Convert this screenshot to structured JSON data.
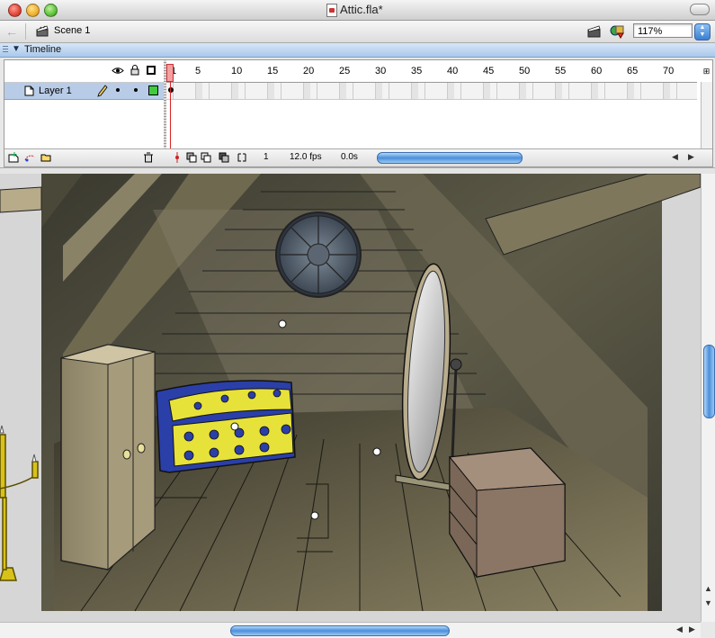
{
  "window": {
    "title": "Attic.fla*"
  },
  "editbar": {
    "scene_label": "Scene 1",
    "zoom": "117%"
  },
  "timeline_panel": {
    "title": "Timeline"
  },
  "timeline": {
    "ruler": [
      "1",
      "5",
      "10",
      "15",
      "20",
      "25",
      "30",
      "35",
      "40",
      "45",
      "50",
      "55",
      "60",
      "65",
      "70"
    ],
    "layer": {
      "name": "Layer 1",
      "color": "#3dcc3d"
    },
    "footer": {
      "current_frame": "1",
      "frame_rate": "12.0 fps",
      "elapsed": "0.0s"
    }
  },
  "stage": {
    "scene": "attic",
    "objects": [
      "round-window-icon",
      "wardrobe",
      "treasure-chest",
      "standing-mirror",
      "dresser",
      "candelabra"
    ],
    "colors": {
      "background": "#4b4a3c",
      "wood": "#a59a7a",
      "chest_blue": "#2b3fa8",
      "chest_yellow": "#e7e23a"
    }
  }
}
